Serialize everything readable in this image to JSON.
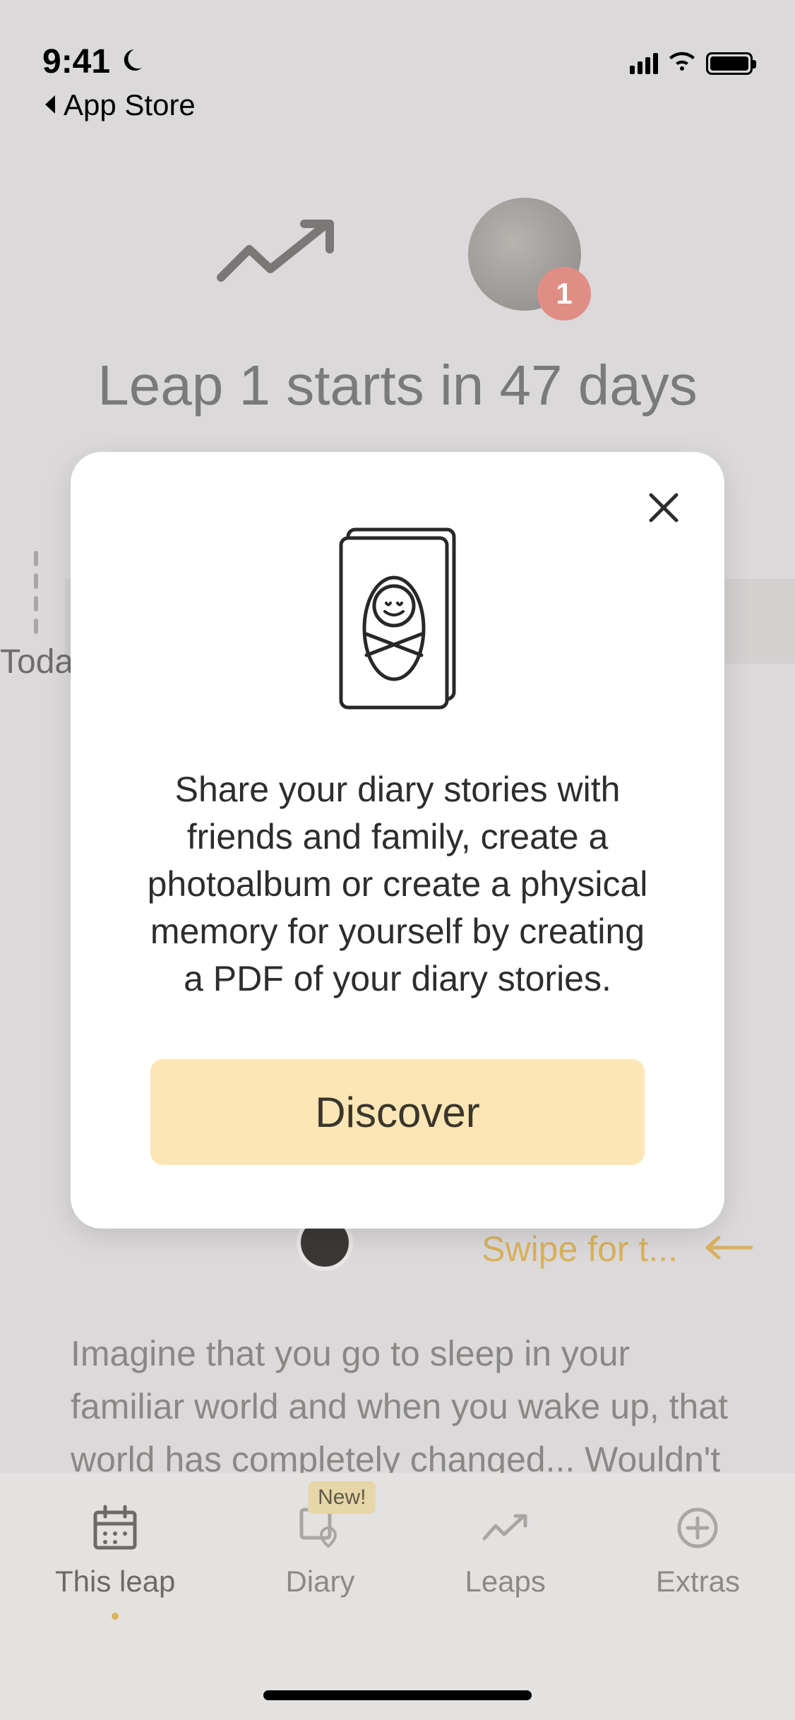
{
  "status_bar": {
    "time": "9:41",
    "back_label": "App Store"
  },
  "header": {
    "avatar_badge_count": "1",
    "leap_title": "Leap 1 starts in 47 days"
  },
  "timeline": {
    "today_label": "Today"
  },
  "swipe": {
    "hint_text": "Swipe for t..."
  },
  "story": {
    "text": "Imagine that you go to sleep in your familiar world and when you wake up, that world has completely changed... Wouldn't it upset you?"
  },
  "tabbar": {
    "this_leap": "This leap",
    "diary": "Diary",
    "diary_badge": "New!",
    "leaps": "Leaps",
    "extras": "Extras"
  },
  "modal": {
    "text": "Share your diary stories with friends and family, create a photoalbum or create a physical memory for yourself by creating a PDF of your diary stories.",
    "cta_label": "Discover"
  }
}
